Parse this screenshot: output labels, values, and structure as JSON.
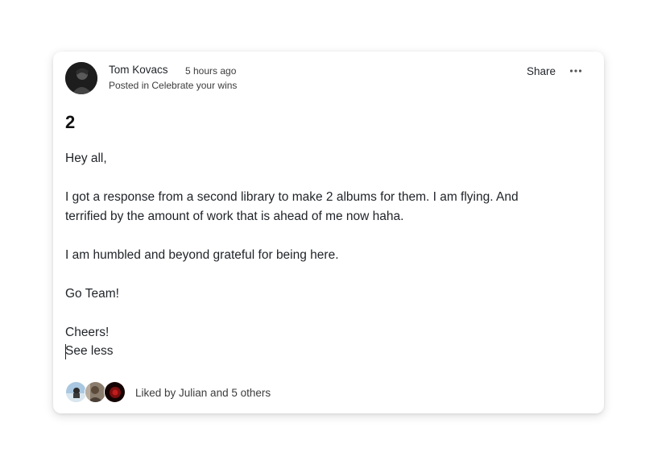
{
  "post": {
    "author": "Tom Kovacs",
    "time": "5 hours ago",
    "posted_in": "Posted in Celebrate your wins",
    "title": "2",
    "paragraphs": [
      "Hey all,",
      "I got a response from a second library to make 2 albums for them. I am flying. And",
      "terrified by the amount of work that is ahead of me now haha.",
      "I am humbled and beyond grateful for being here.",
      "Go Team!",
      "Cheers!"
    ],
    "see_less": "See less"
  },
  "header": {
    "share_label": "Share",
    "more_icon": "more-horizontal-icon"
  },
  "likes": {
    "text": "Liked by Julian and 5 others",
    "avatars": [
      "avatar-1",
      "avatar-2",
      "avatar-3"
    ]
  }
}
